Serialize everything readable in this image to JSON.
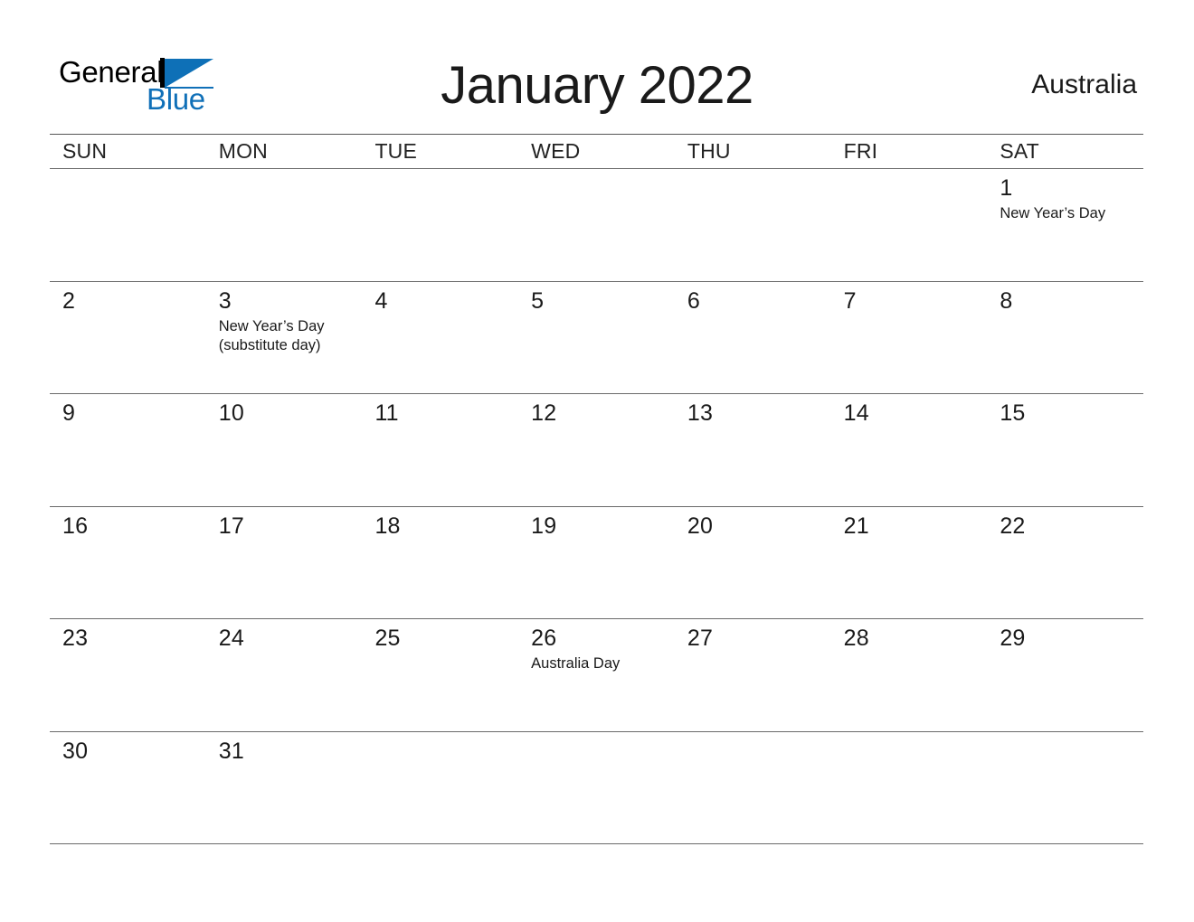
{
  "logo": {
    "line1": "General",
    "line2": "Blue",
    "brand_blue": "#0E70B7",
    "brand_black": "#000000",
    "triangle_icon": "triangle-icon"
  },
  "header": {
    "title": "January 2022",
    "country": "Australia"
  },
  "calendar": {
    "weekdays": [
      "SUN",
      "MON",
      "TUE",
      "WED",
      "THU",
      "FRI",
      "SAT"
    ],
    "weeks": [
      [
        {
          "day": "",
          "events": []
        },
        {
          "day": "",
          "events": []
        },
        {
          "day": "",
          "events": []
        },
        {
          "day": "",
          "events": []
        },
        {
          "day": "",
          "events": []
        },
        {
          "day": "",
          "events": []
        },
        {
          "day": "1",
          "events": [
            "New Year’s Day"
          ]
        }
      ],
      [
        {
          "day": "2",
          "events": []
        },
        {
          "day": "3",
          "events": [
            "New Year’s Day",
            "(substitute day)"
          ]
        },
        {
          "day": "4",
          "events": []
        },
        {
          "day": "5",
          "events": []
        },
        {
          "day": "6",
          "events": []
        },
        {
          "day": "7",
          "events": []
        },
        {
          "day": "8",
          "events": []
        }
      ],
      [
        {
          "day": "9",
          "events": []
        },
        {
          "day": "10",
          "events": []
        },
        {
          "day": "11",
          "events": []
        },
        {
          "day": "12",
          "events": []
        },
        {
          "day": "13",
          "events": []
        },
        {
          "day": "14",
          "events": []
        },
        {
          "day": "15",
          "events": []
        }
      ],
      [
        {
          "day": "16",
          "events": []
        },
        {
          "day": "17",
          "events": []
        },
        {
          "day": "18",
          "events": []
        },
        {
          "day": "19",
          "events": []
        },
        {
          "day": "20",
          "events": []
        },
        {
          "day": "21",
          "events": []
        },
        {
          "day": "22",
          "events": []
        }
      ],
      [
        {
          "day": "23",
          "events": []
        },
        {
          "day": "24",
          "events": []
        },
        {
          "day": "25",
          "events": []
        },
        {
          "day": "26",
          "events": [
            "Australia Day"
          ]
        },
        {
          "day": "27",
          "events": []
        },
        {
          "day": "28",
          "events": []
        },
        {
          "day": "29",
          "events": []
        }
      ],
      [
        {
          "day": "30",
          "events": []
        },
        {
          "day": "31",
          "events": []
        },
        {
          "day": "",
          "events": []
        },
        {
          "day": "",
          "events": []
        },
        {
          "day": "",
          "events": []
        },
        {
          "day": "",
          "events": []
        },
        {
          "day": "",
          "events": []
        }
      ]
    ]
  }
}
